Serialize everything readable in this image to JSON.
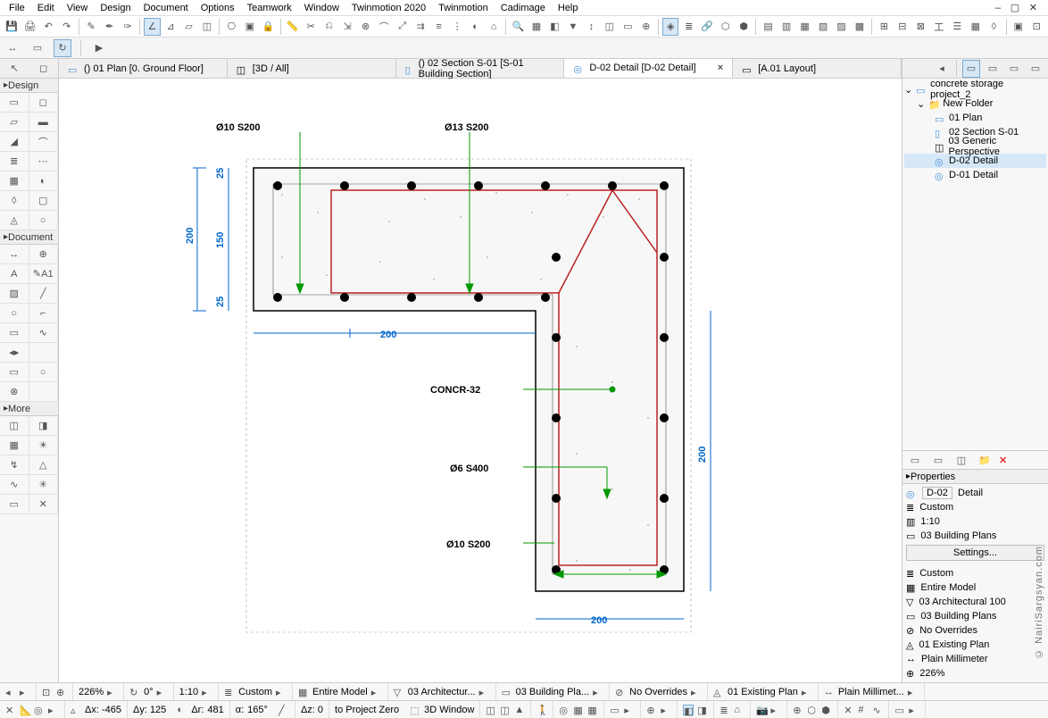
{
  "menu": {
    "items": [
      "File",
      "Edit",
      "View",
      "Design",
      "Document",
      "Options",
      "Teamwork",
      "Window",
      "Twinmotion 2020",
      "Twinmotion",
      "Cadimage",
      "Help"
    ]
  },
  "tabs": [
    {
      "icon": "plan",
      "label": "() 01 Plan [0. Ground Floor]"
    },
    {
      "icon": "cube",
      "label": "[3D / All]"
    },
    {
      "icon": "section",
      "label": "() 02 Section S-01 [S-01 Building Section]"
    },
    {
      "icon": "detail",
      "label": "D-02 Detail [D-02 Detail]",
      "active": true,
      "closable": true
    },
    {
      "icon": "layout",
      "label": "[A.01 Layout]"
    }
  ],
  "toolgroups": {
    "design": {
      "title": "Design"
    },
    "document": {
      "title": "Document"
    },
    "more": {
      "title": "More"
    }
  },
  "navigator": {
    "project": "concrete storage project_2",
    "folder": "New Folder",
    "items": [
      {
        "icon": "plan",
        "label": "01 Plan"
      },
      {
        "icon": "section",
        "label": "02 Section S-01"
      },
      {
        "icon": "persp",
        "label": "03 Generic Perspective"
      },
      {
        "icon": "detail",
        "label": "D-02 Detail",
        "selected": true
      },
      {
        "icon": "detail",
        "label": "D-01 Detail"
      }
    ]
  },
  "properties": {
    "head": "Properties",
    "id": "D-02",
    "type": "Detail",
    "layer": "Custom",
    "scale": "1:10",
    "plan": "03 Building Plans",
    "settings": "Settings..."
  },
  "quick": {
    "items": [
      {
        "icon": "layer",
        "label": "Custom"
      },
      {
        "icon": "model",
        "label": "Entire Model"
      },
      {
        "icon": "cut",
        "label": "03 Architectural 100"
      },
      {
        "icon": "plan",
        "label": "03 Building Plans"
      },
      {
        "icon": "override",
        "label": "No Overrides"
      },
      {
        "icon": "exist",
        "label": "01 Existing Plan"
      },
      {
        "icon": "dim",
        "label": "Plain Millimeter"
      },
      {
        "icon": "zoom",
        "label": "226%"
      }
    ]
  },
  "drawing": {
    "rebar1": "Ø10 S200",
    "rebar2": "Ø13 S200",
    "rebar3": "Ø6 S400",
    "rebar4": "Ø10 S200",
    "material": "CONCR-32",
    "dim25a": "25",
    "dim25b": "25",
    "dim150": "150",
    "dim200v": "200",
    "dim200h1": "200",
    "dim200h2": "200",
    "dim200r": "200"
  },
  "status1": {
    "zoom": "226%",
    "angle": "0°",
    "scale": "1:10",
    "layer": "Custom",
    "model": "Entire Model",
    "cut": "03 Architectur...",
    "plan": "03 Building Pla...",
    "override": "No Overrides",
    "exist": "01 Existing Plan",
    "dim": "Plain Millimet..."
  },
  "status2": {
    "dx": "Δx: -465",
    "dy": "Δy: 125",
    "dr_lab": "Δr:",
    "dr": "481",
    "a_lab": "α:",
    "a": "165°",
    "dz": "Δz: 0",
    "ref": "to Project Zero",
    "view": "3D Window"
  },
  "watermark": "© NairiSargsyan.com"
}
